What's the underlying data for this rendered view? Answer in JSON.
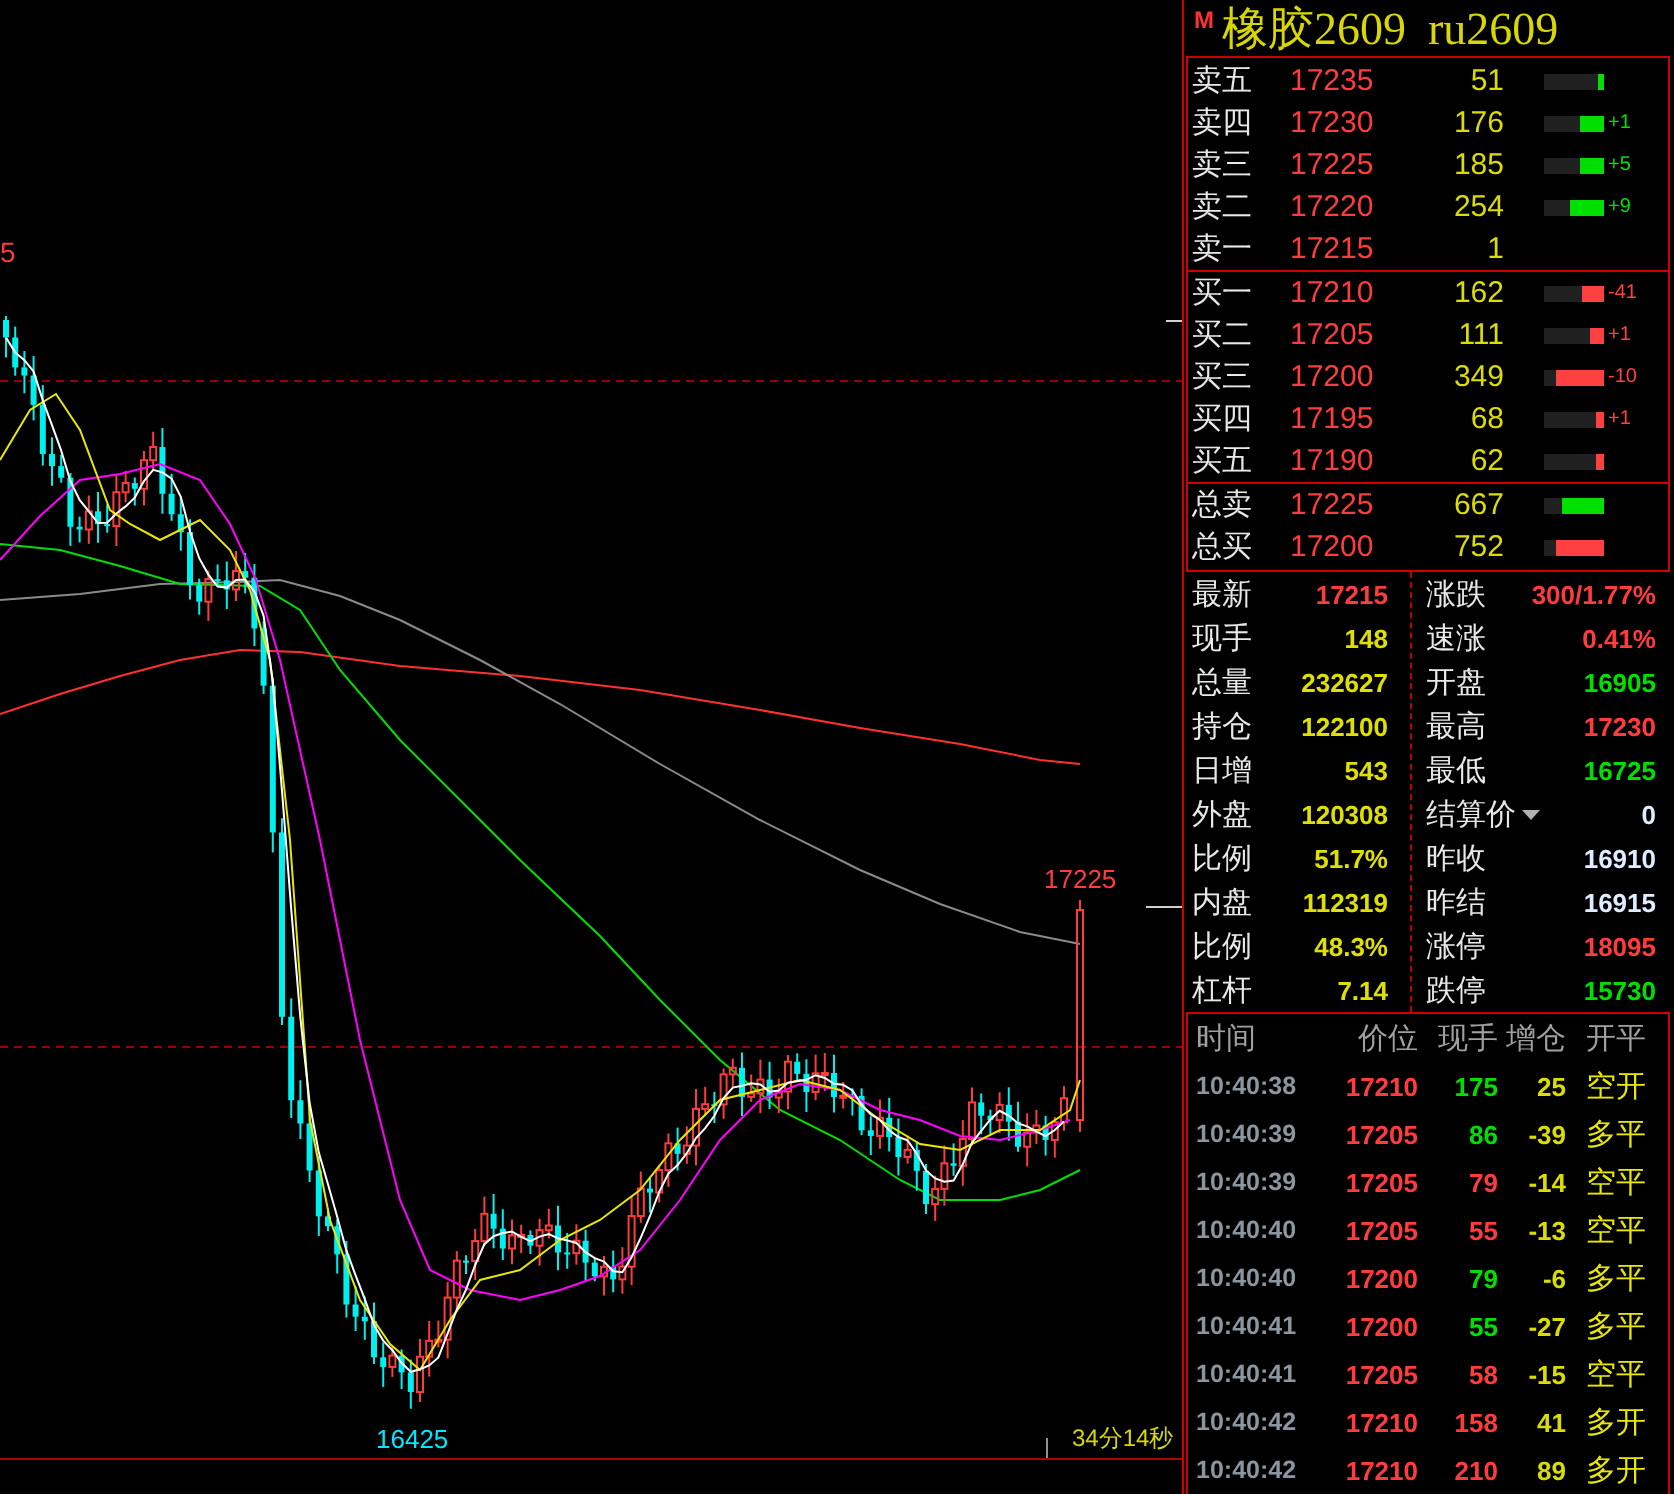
{
  "chart": {
    "edge_label": "5",
    "high_label": "17225",
    "low_label": "16425",
    "countdown": "34分14秒"
  },
  "quote": {
    "badge": "M",
    "name": "橡胶2609",
    "code": "ru2609"
  },
  "order_book": {
    "sell": [
      {
        "label": "卖五",
        "price": "17235",
        "volume": "51",
        "level": 0.1
      },
      {
        "label": "卖四",
        "price": "17230",
        "volume": "176",
        "level": 0.4,
        "change": "+1"
      },
      {
        "label": "卖三",
        "price": "17225",
        "volume": "185",
        "level": 0.4,
        "change": "+5"
      },
      {
        "label": "卖二",
        "price": "17220",
        "volume": "254",
        "level": 0.57,
        "change": "+9"
      },
      {
        "label": "卖一",
        "price": "17215",
        "volume": "1"
      }
    ],
    "buy": [
      {
        "label": "买一",
        "price": "17210",
        "volume": "162",
        "level": 0.37,
        "change": "-41"
      },
      {
        "label": "买二",
        "price": "17205",
        "volume": "111",
        "level": 0.23,
        "change": "+1"
      },
      {
        "label": "买三",
        "price": "17200",
        "volume": "349",
        "level": 0.8,
        "change": "-10"
      },
      {
        "label": "买四",
        "price": "17195",
        "volume": "68",
        "level": 0.13,
        "change": "+1"
      },
      {
        "label": "买五",
        "price": "17190",
        "volume": "62",
        "level": 0.13
      }
    ],
    "totals": [
      {
        "label": "总卖",
        "price": "17225",
        "volume": "667",
        "level": 0.7,
        "kind": "sell"
      },
      {
        "label": "总买",
        "price": "17200",
        "volume": "752",
        "level": 0.8,
        "kind": "buy"
      }
    ]
  },
  "stats": {
    "left": [
      {
        "label": "最新",
        "value": "17215",
        "color": "#ff3c3c"
      },
      {
        "label": "现手",
        "value": "148",
        "color": "#e0e000"
      },
      {
        "label": "总量",
        "value": "232627",
        "color": "#e0e000"
      },
      {
        "label": "持仓",
        "value": "122100",
        "color": "#e0e000"
      },
      {
        "label": "日增",
        "value": "543",
        "color": "#e0e000"
      },
      {
        "label": "外盘",
        "value": "120308",
        "color": "#e0e000"
      },
      {
        "label": "比例",
        "value": "51.7%",
        "color": "#e0e000"
      },
      {
        "label": "内盘",
        "value": "112319",
        "color": "#e0e000"
      },
      {
        "label": "比例",
        "value": "48.3%",
        "color": "#e0e000"
      },
      {
        "label": "杠杆",
        "value": "7.14",
        "color": "#e0e000"
      }
    ],
    "right": [
      {
        "label": "涨跌",
        "value": "300/1.77%",
        "color": "#ff3c3c"
      },
      {
        "label": "速涨",
        "value": "0.41%",
        "color": "#ff3c3c"
      },
      {
        "label": "开盘",
        "value": "16905",
        "color": "#00e000"
      },
      {
        "label": "最高",
        "value": "17230",
        "color": "#ff3c3c"
      },
      {
        "label": "最低",
        "value": "16725",
        "color": "#00e000"
      },
      {
        "label": "结算价",
        "value": "0",
        "color": "#e0ecff",
        "dropdown": true
      },
      {
        "label": "昨收",
        "value": "16910",
        "color": "#e0ecff"
      },
      {
        "label": "昨结",
        "value": "16915",
        "color": "#e0ecff"
      },
      {
        "label": "涨停",
        "value": "18095",
        "color": "#ff3c3c"
      },
      {
        "label": "跌停",
        "value": "15730",
        "color": "#00e000"
      }
    ]
  },
  "trades": {
    "columns": [
      "时间",
      "价位",
      "现手",
      "增仓",
      "开平"
    ],
    "rows": [
      {
        "time": "10:40:38",
        "price": "17210",
        "volume": "175",
        "color": "#00e000",
        "change": "25",
        "action": "空开"
      },
      {
        "time": "10:40:39",
        "price": "17205",
        "volume": "86",
        "color": "#00e000",
        "change": "-39",
        "action": "多平"
      },
      {
        "time": "10:40:39",
        "price": "17205",
        "volume": "79",
        "color": "#ff3c3c",
        "change": "-14",
        "action": "空平"
      },
      {
        "time": "10:40:40",
        "price": "17205",
        "volume": "55",
        "color": "#ff3c3c",
        "change": "-13",
        "action": "空平"
      },
      {
        "time": "10:40:40",
        "price": "17200",
        "volume": "79",
        "color": "#00e000",
        "change": "-6",
        "action": "多平"
      },
      {
        "time": "10:40:41",
        "price": "17200",
        "volume": "55",
        "color": "#00e000",
        "change": "-27",
        "action": "多平"
      },
      {
        "time": "10:40:41",
        "price": "17205",
        "volume": "58",
        "color": "#ff3c3c",
        "change": "-15",
        "action": "空平"
      },
      {
        "time": "10:40:42",
        "price": "17210",
        "volume": "158",
        "color": "#ff3c3c",
        "change": "41",
        "action": "多开"
      },
      {
        "time": "10:40:42",
        "price": "17210",
        "volume": "210",
        "color": "#ff3c3c",
        "change": "89",
        "action": "多开"
      }
    ]
  }
}
